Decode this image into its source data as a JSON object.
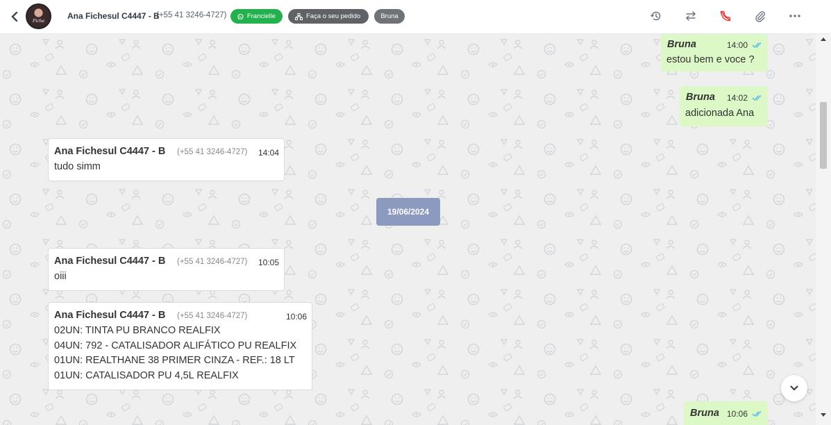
{
  "header": {
    "contact_name": "Ana Fichesul C4447 - B",
    "contact_phone": "(+55 41 3246-4727)",
    "avatar_text": "Ficha",
    "tags": [
      {
        "label": "Francielle",
        "icon": "whatsapp-icon",
        "color": "#22b14c"
      },
      {
        "label": "Faça o seu pedido",
        "icon": "sitemap-icon",
        "color": "#5f6368"
      },
      {
        "label": "Bruna",
        "color": "#6e737a"
      }
    ],
    "actions": [
      "history-icon",
      "transfer-icon",
      "end-call-icon",
      "attach-icon",
      "more-icon"
    ]
  },
  "messages": [
    {
      "direction": "out",
      "sender": "Bruna",
      "time": "14:00",
      "lines": [
        "estou bem e voce ?"
      ]
    },
    {
      "direction": "out",
      "sender": "Bruna",
      "time": "14:02",
      "lines": [
        "adicionada Ana"
      ]
    },
    {
      "direction": "in",
      "sender": "Ana Fichesul C4447 - B",
      "phone": "(+55 41 3246-4727)",
      "time": "14:04",
      "lines": [
        "tudo simm"
      ]
    },
    {
      "direction": "in",
      "sender": "Ana Fichesul C4447 - B",
      "phone": "(+55 41 3246-4727)",
      "time": "10:05",
      "lines": [
        "oiii"
      ]
    },
    {
      "direction": "in",
      "sender": "Ana Fichesul C4447 - B",
      "phone": "(+55 41 3246-4727)",
      "time": "10:06",
      "lines": [
        "02UN: TINTA PU BRANCO REALFIX",
        "04UN: 792 - CATALISADOR ALIFÁTICO PU REALFIX",
        "01UN: REALTHANE 38 PRIMER CINZA - REF.: 18 LT",
        "01UN: CATALISADOR PU 4,5L REALFIX"
      ]
    },
    {
      "direction": "out",
      "sender": "Bruna",
      "time": "10:06",
      "lines": []
    }
  ],
  "date_separator": "19/06/2024",
  "colors": {
    "outgoing_bubble": "#dcf8c6",
    "read_ticks": "#4fb6ec",
    "date_badge": "#8d9ac0",
    "end_call": "#e53935"
  }
}
